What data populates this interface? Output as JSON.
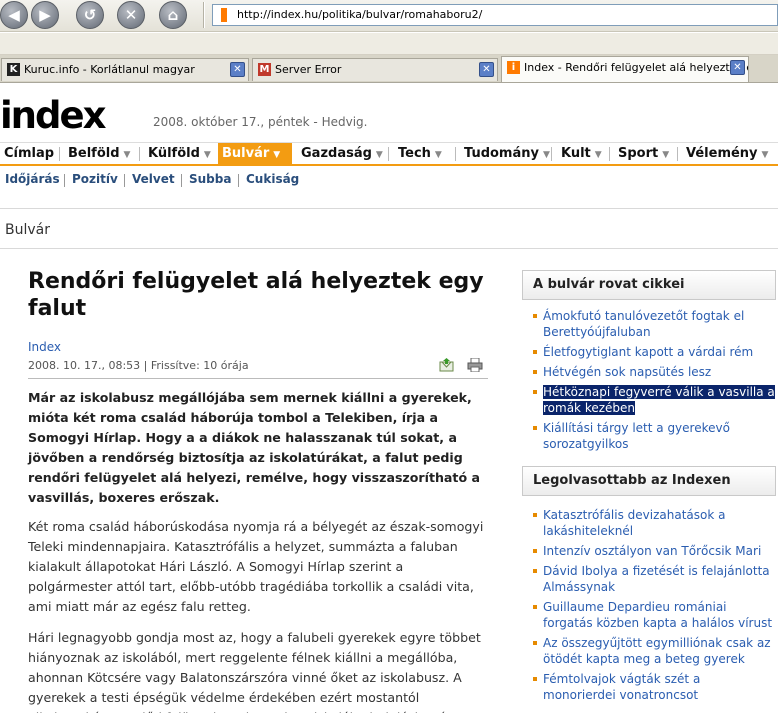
{
  "browser": {
    "url": "http://index.hu/politika/bulvar/romahaboru2/",
    "tabs": [
      {
        "label": "Kuruc.info - Korlátlanul magyar",
        "favicon": "K",
        "favicon_color": "#222222"
      },
      {
        "label": "Server Error",
        "favicon": "M",
        "favicon_color": "#c0392b"
      },
      {
        "label": "Index - Rendőri felügyelet alá helyeztek egy falut",
        "favicon": "i",
        "favicon_color": "#ff7a00"
      }
    ],
    "close_glyph": "✕"
  },
  "site": {
    "logo": "index",
    "date": "2008. október 17., péntek - Hedvig.",
    "nav": [
      "Címlap",
      "Belföld",
      "Külföld",
      "Bulvár",
      "Gazdaság",
      "Tech",
      "Tudomány",
      "Kult",
      "Sport",
      "Vélemény"
    ],
    "nav_active": "Bulvár",
    "accent_color": "#f39c12",
    "subnav": [
      "Időjárás",
      "Pozitív",
      "Velvet",
      "Subba",
      "Cukiság"
    ],
    "section": "Bulvár"
  },
  "article": {
    "title": "Rendőri felügyelet alá helyeztek egy falut",
    "source": "Index",
    "meta": "2008. 10. 17., 08:53 | Frissítve: 10 órája",
    "lead": "Már az iskolabusz megállójába sem mernek kiállni a gyerekek, mióta két roma család háborúja tombol a Telekiben, írja a Somogyi Hírlap. Hogy a a diákok ne halasszanak túl sokat, a jövőben a rendőrség biztosítja az iskolatúrákat, a falut pedig rendőri felügyelet alá helyezi, remélve, hogy visszaszorítható a vasvillás, boxeres erőszak.",
    "para1": "Két roma család háborúskodása nyomja rá a bélyegét az észak-somogyi Teleki mindennapjaira. Katasztrófális a helyzet, summázta a faluban kialakult állapotokat Hári László. A Somogyi Hírlap szerint a polgármester attól tart, előbb-utóbb tragédiába torkollik a családi vita, ami miatt már az egész falu retteg.",
    "para2": "Hári legnagyobb gondja most az, hogy a falubeli gyerekek egyre többet hiányoznak az iskolából, mert reggelente félnek kiállni a megállóba, ahonnan Kötcsére vagy Balatonszárszóra vinné őket az iskolabusz. A gyerekek a testi épségük védelme érdekében ezért mostantól alkalmanként rendőri felügyeletet kapnak az iskolába induláskor és"
  },
  "sidebar": {
    "box1_title": "A bulvár rovat cikkei",
    "box1_items": [
      "Ámokfutó tanulóvezetőt fogtak el Berettyóújfaluban",
      "Életfogytiglant kapott a várdai rém",
      "Hétvégén sok napsütés lesz",
      "Hétköznapi fegyverré válik a vasvilla a romák kezében",
      "Kiállítási tárgy lett a gyerekevő sorozatgyilkos"
    ],
    "box1_highlighted_index": 3,
    "box2_title": "Legolvasottabb az Indexen",
    "box2_items": [
      "Katasztrófális devizahatások a lakáshiteleknél",
      "Intenzív osztályon van Tőrőcsik Mari",
      "Dávid Ibolya a fizetését is felajánlotta Almássynak",
      "Guillaume Depardieu romániai forgatás közben kapta a halálos vírust",
      "Az összegyűjtött egymilliónak csak az ötödét kapta meg a beteg gyerek",
      "Fémtolvajok vágták szét a monorierdei vonatroncsot"
    ]
  }
}
